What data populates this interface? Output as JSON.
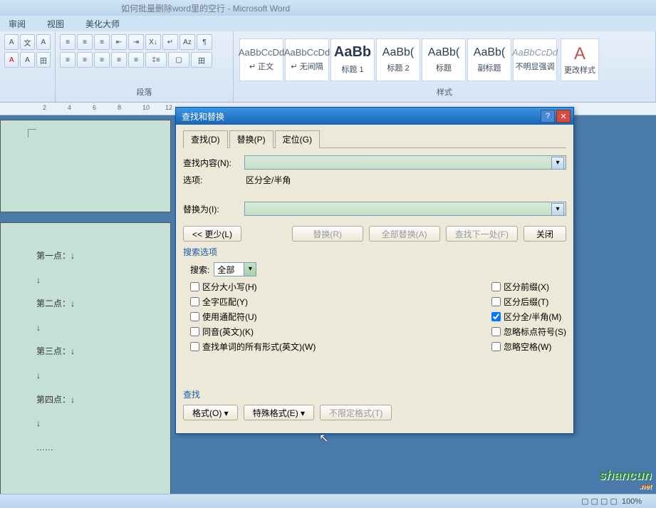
{
  "window": {
    "title": "如何批量删除word里的空行 - Microsoft Word"
  },
  "menu": {
    "review": "审阅",
    "view": "视图",
    "beautify": "美化大师"
  },
  "ribbon": {
    "paragraph_label": "段落",
    "styles_label": "样式",
    "styles": [
      {
        "preview": "AaBbCcDd",
        "label": "↵ 正文"
      },
      {
        "preview": "AaBbCcDd",
        "label": "↵ 无间隔"
      },
      {
        "preview": "AaBb",
        "label": "标题 1"
      },
      {
        "preview": "AaBb(",
        "label": "标题 2"
      },
      {
        "preview": "AaBb(",
        "label": "标题"
      },
      {
        "preview": "AaBb(",
        "label": "副标题"
      },
      {
        "preview": "AaBbCcDd",
        "label": "不明显强调"
      }
    ],
    "change_style": "更改样式"
  },
  "ruler": {
    "marks": [
      "2",
      "4",
      "6",
      "8",
      "10",
      "12"
    ]
  },
  "document": {
    "lines": [
      "第一点：↓",
      "↓",
      "第二点：↓",
      "↓",
      "第三点：↓",
      "↓",
      "第四点：↓",
      "↓",
      "……"
    ]
  },
  "dialog": {
    "title": "查找和替换",
    "tabs": {
      "find": "查找(D)",
      "replace": "替换(P)",
      "goto": "定位(G)"
    },
    "find_label": "查找内容(N):",
    "options_label": "选项:",
    "options_value": "区分全/半角",
    "replace_label": "替换为(I):",
    "less_btn": "<< 更少(L)",
    "replace_btn": "替换(R)",
    "replace_all_btn": "全部替换(A)",
    "find_next_btn": "查找下一处(F)",
    "close_btn": "关闭",
    "search_options_label": "搜索选项",
    "search_label": "搜索:",
    "search_value": "全部",
    "checkboxes_left": [
      {
        "label": "区分大小写(H)",
        "checked": false
      },
      {
        "label": "全字匹配(Y)",
        "checked": false
      },
      {
        "label": "使用通配符(U)",
        "checked": false
      },
      {
        "label": "同音(英文)(K)",
        "checked": false
      },
      {
        "label": "查找单词的所有形式(英文)(W)",
        "checked": false
      }
    ],
    "checkboxes_right": [
      {
        "label": "区分前缀(X)",
        "checked": false
      },
      {
        "label": "区分后缀(T)",
        "checked": false
      },
      {
        "label": "区分全/半角(M)",
        "checked": true
      },
      {
        "label": "忽略标点符号(S)",
        "checked": false
      },
      {
        "label": "忽略空格(W)",
        "checked": false
      }
    ],
    "find_section_label": "查找",
    "format_btn": "格式(O) ▾",
    "special_btn": "特殊格式(E) ▾",
    "no_format_btn": "不限定格式(T)"
  },
  "status": {
    "zoom": "100%"
  },
  "watermark": {
    "text": "shancun",
    "sub": ".net"
  }
}
